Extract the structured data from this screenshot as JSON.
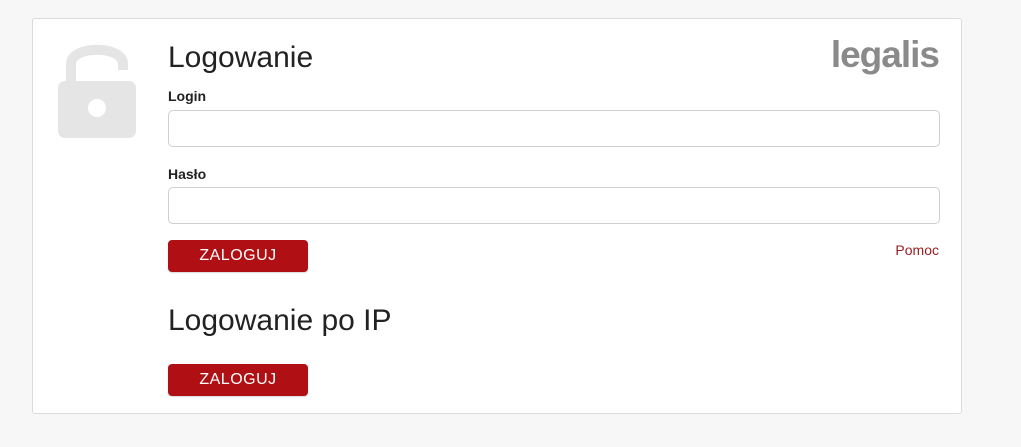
{
  "brand": {
    "logo_text": "legalis",
    "accent_color": "#b01014"
  },
  "login_form": {
    "title": "Logowanie",
    "login_label": "Login",
    "login_value": "",
    "password_label": "Hasło",
    "password_value": "",
    "submit_label": "ZALOGUJ",
    "help_link": "Pomoc"
  },
  "ip_login": {
    "title": "Logowanie po IP",
    "submit_label": "ZALOGUJ"
  },
  "icons": {
    "lock": "lock-open-icon"
  }
}
